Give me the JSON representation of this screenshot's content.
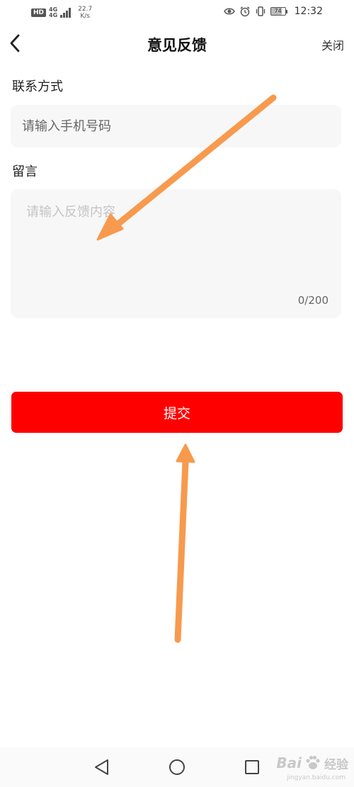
{
  "status_bar": {
    "hd_label": "HD",
    "net_type_top": "4G",
    "net_type_bottom": "4G",
    "speed_value": "22.7",
    "speed_unit": "K/s",
    "battery_level": "74",
    "time": "12:32",
    "icons": [
      "eye-icon",
      "alarm-icon",
      "vibrate-icon",
      "battery-icon"
    ]
  },
  "header": {
    "back_icon": "chevron-left-icon",
    "title": "意见反馈",
    "close_label": "关闭"
  },
  "form": {
    "contact_label": "联系方式",
    "phone_placeholder": "请输入手机号码",
    "phone_value": "",
    "message_label": "留言",
    "message_placeholder": "请输入反馈内容",
    "message_value": "",
    "char_count": "0/200",
    "submit_label": "提交"
  },
  "colors": {
    "submit_bg": "#ff0000",
    "input_bg": "#f7f7f7",
    "arrow": "#f79a4e"
  },
  "nav_bar": {
    "icons": [
      "nav-back-icon",
      "nav-home-icon",
      "nav-recent-icon"
    ]
  },
  "watermark": {
    "brand": "Bai",
    "brand_suffix": "经验",
    "sub": "jingyan.baidu.com"
  }
}
